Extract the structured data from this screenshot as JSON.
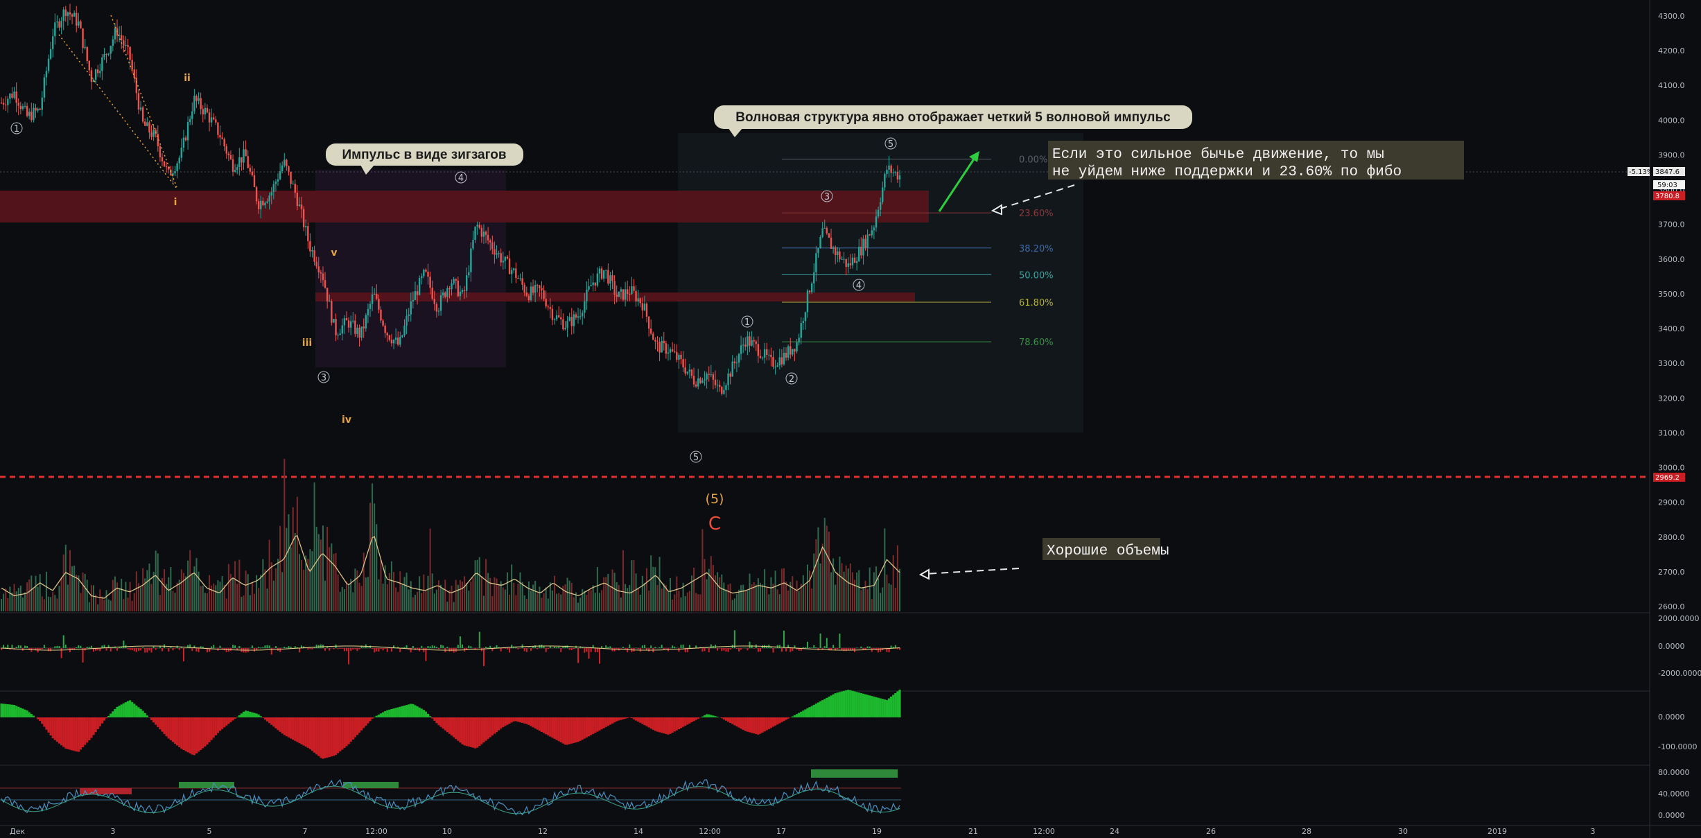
{
  "chart_data": {
    "type": "candlestick",
    "price_axis": {
      "ticks": [
        "4300.0",
        "4200.0",
        "4100.0",
        "4000.0",
        "3900.0",
        "3800.0",
        "3700.0",
        "3600.0",
        "3500.0",
        "3400.0",
        "3300.0",
        "3200.0",
        "3100.0",
        "3000.0",
        "2900.0",
        "2800.0",
        "2700.0",
        "2600.0"
      ],
      "tick_values": [
        4300,
        4200,
        4100,
        4000,
        3900,
        3800,
        3700,
        3600,
        3500,
        3400,
        3300,
        3200,
        3100,
        3000,
        2900,
        2800,
        2700,
        2600
      ]
    },
    "time_axis": {
      "labels": [
        "Дек",
        "3",
        "5",
        "7",
        "12:00",
        "10",
        "12",
        "14",
        "12:00",
        "17",
        "19",
        "21",
        "12:00",
        "24",
        "26",
        "28",
        "30",
        "2019",
        "3"
      ]
    },
    "price_tags": {
      "change": "-5.13%",
      "last": "3847.6",
      "countdown": "59:03",
      "red_level": "3780.8",
      "support": "2969.2"
    },
    "fib_levels": [
      {
        "label": "0.00%",
        "value": 3888,
        "color": "#5c6068"
      },
      {
        "label": "23.60%",
        "value": 3733,
        "color": "#8a3a3a"
      },
      {
        "label": "38.20%",
        "value": 3632,
        "color": "#3f6aa3"
      },
      {
        "label": "50.00%",
        "value": 3555,
        "color": "#3aa5a0"
      },
      {
        "label": "61.80%",
        "value": 3476,
        "color": "#b2b03a"
      },
      {
        "label": "78.60%",
        "value": 3362,
        "color": "#3a8f46"
      }
    ],
    "close_path": [
      4050,
      4080,
      4010,
      4030,
      4250,
      4320,
      4280,
      4120,
      4180,
      4260,
      4180,
      3990,
      3950,
      3840,
      3900,
      4060,
      4020,
      3960,
      3870,
      3900,
      3760,
      3790,
      3880,
      3780,
      3640,
      3560,
      3390,
      3420,
      3380,
      3500,
      3390,
      3350,
      3480,
      3560,
      3460,
      3540,
      3490,
      3700,
      3650,
      3600,
      3560,
      3500,
      3510,
      3440,
      3410,
      3440,
      3530,
      3570,
      3490,
      3510,
      3470,
      3350,
      3340,
      3300,
      3250,
      3270,
      3220,
      3290,
      3370,
      3340,
      3300,
      3320,
      3360,
      3520,
      3680,
      3620,
      3580,
      3630,
      3700,
      3860,
      3840
    ],
    "volume_path": [
      0.18,
      0.12,
      0.14,
      0.22,
      0.16,
      0.3,
      0.25,
      0.12,
      0.1,
      0.18,
      0.15,
      0.2,
      0.28,
      0.16,
      0.22,
      0.3,
      0.18,
      0.14,
      0.26,
      0.2,
      0.24,
      0.34,
      0.4,
      0.6,
      0.3,
      0.45,
      0.35,
      0.2,
      0.28,
      0.6,
      0.25,
      0.22,
      0.18,
      0.16,
      0.2,
      0.14,
      0.18,
      0.3,
      0.22,
      0.2,
      0.25,
      0.18,
      0.14,
      0.22,
      0.15,
      0.12,
      0.18,
      0.22,
      0.16,
      0.14,
      0.2,
      0.28,
      0.15,
      0.18,
      0.24,
      0.3,
      0.18,
      0.14,
      0.16,
      0.2,
      0.18,
      0.22,
      0.16,
      0.24,
      0.5,
      0.3,
      0.22,
      0.18,
      0.2,
      0.4,
      0.3
    ]
  },
  "annotations": {
    "callout_zigzag": "Импульс в виде зигзагов",
    "callout_wave": "Волновая структура явно отображает четкий 5 волновой импульс",
    "note_bullish_line1": "Если это сильное бычье движение, то мы",
    "note_bullish_line2": "не уйдем ниже поддержки  и 23.60% по фибо",
    "note_volume": "Хорошие объемы",
    "label_5_paren": "(5)",
    "label_c": "C"
  },
  "wave_labels": {
    "circled": [
      "1",
      "3",
      "4",
      "1",
      "2",
      "3",
      "4",
      "5",
      "5"
    ],
    "roman": [
      "ii",
      "i",
      "v",
      "iii",
      "iv"
    ]
  },
  "indicator_axes": {
    "macd": [
      "2000.0000",
      "0.0000",
      "-2000.0000"
    ],
    "osc": [
      "0.0000",
      "-100.0000"
    ],
    "rsi": [
      "80.0000",
      "40.0000",
      "0.0000"
    ]
  },
  "colors": {
    "bull": "#26a69a",
    "bear": "#ef5350",
    "support": "#e03131",
    "zone": "#6b1b24",
    "accent_arrow": "#2ecc40"
  }
}
